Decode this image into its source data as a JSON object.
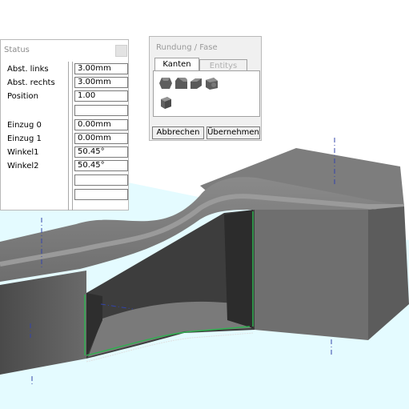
{
  "status_panel": {
    "title": "Status",
    "rows": [
      {
        "label": "Abst. links",
        "value": "3.00mm"
      },
      {
        "label": "Abst. rechts",
        "value": "3.00mm"
      },
      {
        "label": "Position",
        "value": "1.00"
      },
      {
        "label": "",
        "value": ""
      },
      {
        "label": "Einzug 0",
        "value": "0.00mm"
      },
      {
        "label": "Einzug 1",
        "value": "0.00mm"
      },
      {
        "label": "Winkel1",
        "value": "50.45°"
      },
      {
        "label": "Winkel2",
        "value": "50.45°"
      },
      {
        "label": "",
        "value": ""
      },
      {
        "label": "",
        "value": ""
      }
    ]
  },
  "fillet_dialog": {
    "title": "Rundung / Fase",
    "tabs": [
      {
        "label": "Kanten",
        "active": true
      },
      {
        "label": "Entitys",
        "active": false
      }
    ],
    "tools": [
      "fillet-vertex-icon",
      "fillet-edge-icon",
      "chamfer-edge-icon",
      "fillet-face-icon",
      "fillet-solid-icon"
    ],
    "cancel_label": "Abbrechen",
    "apply_label": "Übernehmen"
  },
  "viewport": {
    "model": "sheet-metal-offset-duct",
    "colors": {
      "solid": "#6b6b6b",
      "ground": "#dff9ff",
      "edge_highlight": "#22aa44",
      "axis": "#3344aa"
    }
  }
}
